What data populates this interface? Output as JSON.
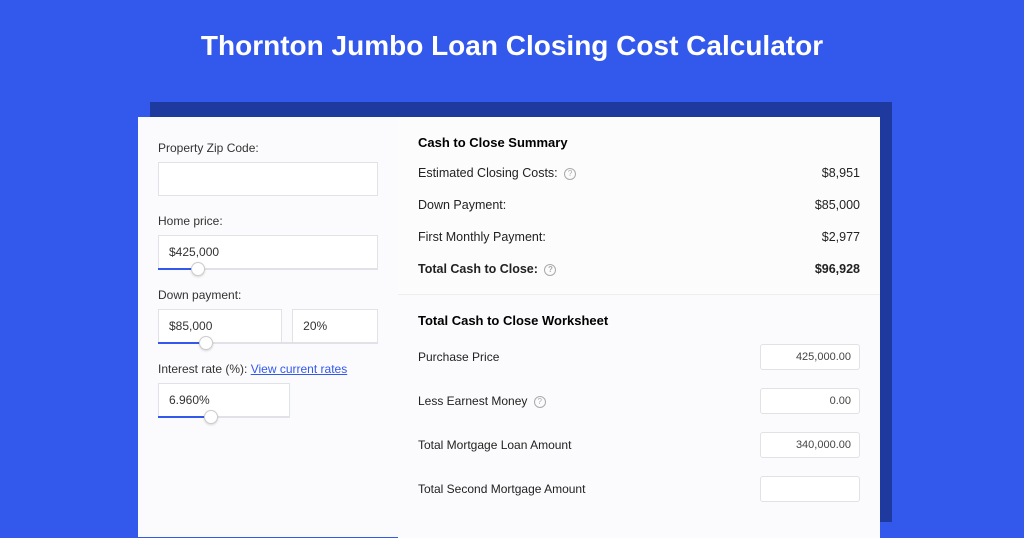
{
  "page_title": "Thornton Jumbo Loan Closing Cost Calculator",
  "form": {
    "zip": {
      "label": "Property Zip Code:",
      "value": ""
    },
    "home_price": {
      "label": "Home price:",
      "value": "$425,000",
      "slider_pct": 18
    },
    "down_payment": {
      "label": "Down payment:",
      "value": "$85,000",
      "pct": "20%",
      "slider_pct": 22
    },
    "interest_rate": {
      "label": "Interest rate (%):",
      "link_text": "View current rates",
      "value": "6.960%",
      "slider_pct": 40
    }
  },
  "summary": {
    "title": "Cash to Close Summary",
    "est_closing": {
      "label": "Estimated Closing Costs:",
      "value": "$8,951",
      "help": true
    },
    "down_payment": {
      "label": "Down Payment:",
      "value": "$85,000",
      "help": false
    },
    "first_monthly": {
      "label": "First Monthly Payment:",
      "value": "$2,977",
      "help": false
    },
    "total": {
      "label": "Total Cash to Close:",
      "value": "$96,928",
      "help": true
    }
  },
  "worksheet": {
    "title": "Total Cash to Close Worksheet",
    "purchase_price": {
      "label": "Purchase Price",
      "value": "425,000.00",
      "help": false
    },
    "less_earnest": {
      "label": "Less Earnest Money",
      "value": "0.00",
      "help": true
    },
    "total_mortgage": {
      "label": "Total Mortgage Loan Amount",
      "value": "340,000.00",
      "help": false
    },
    "second_mortgage": {
      "label": "Total Second Mortgage Amount",
      "value": "",
      "help": false
    }
  }
}
